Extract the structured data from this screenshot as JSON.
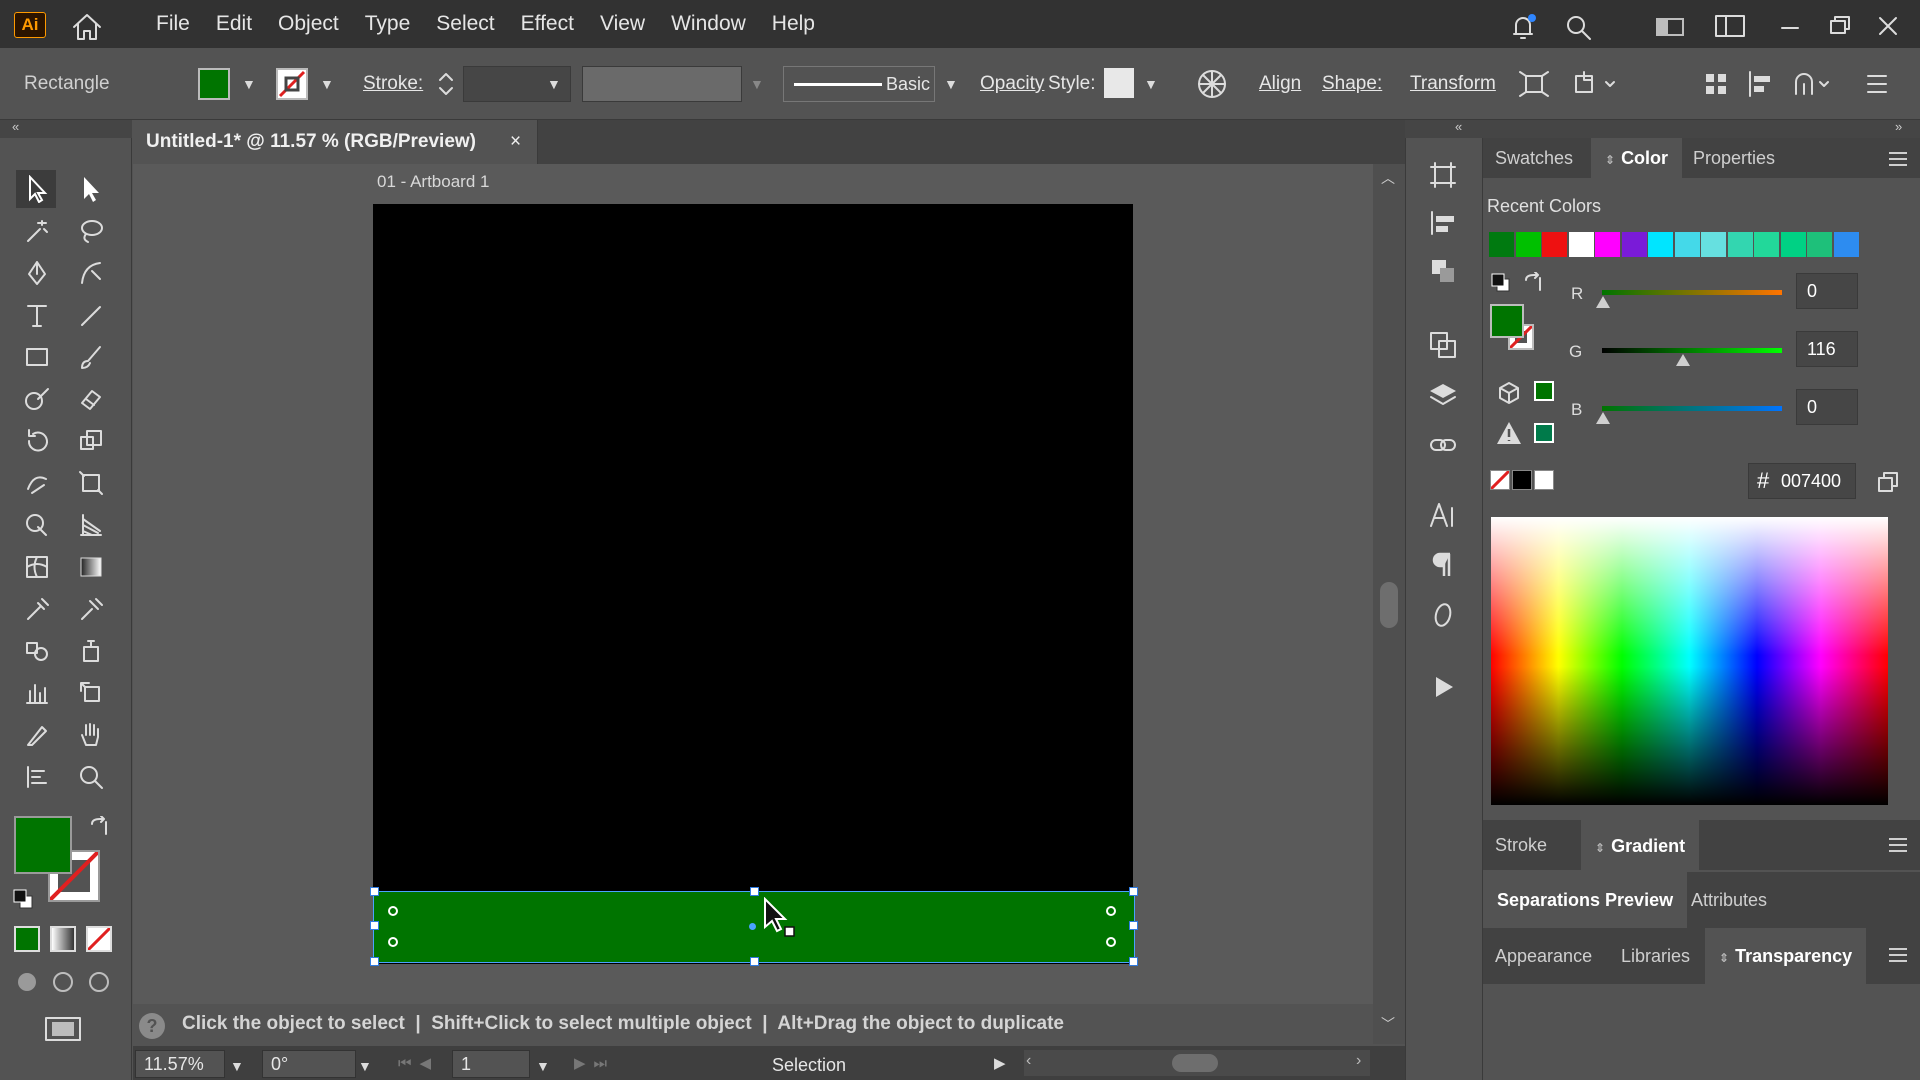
{
  "app": {
    "logo": "Ai"
  },
  "menu": [
    "File",
    "Edit",
    "Object",
    "Type",
    "Select",
    "Effect",
    "View",
    "Window",
    "Help"
  ],
  "control_bar": {
    "selection_label": "Rectangle",
    "fill_color": "#007400",
    "stroke_label": "Stroke:",
    "brush_label": "Basic",
    "opacity_label": "Opacity",
    "style_label": "Style:",
    "align_label": "Align",
    "shape_label": "Shape:",
    "transform_label": "Transform"
  },
  "document": {
    "tab_title": "Untitled-1* @ 11.57 % (RGB/Preview)",
    "tab_close": "×",
    "artboard_label": "01 - Artboard 1",
    "artboard_color": "#000000",
    "rect_color": "#007400"
  },
  "hint": {
    "text": "Click the object to select  |  Shift+Click to select multiple object  |  Alt+Drag the object to duplicate",
    "help_icon": "?"
  },
  "status": {
    "zoom": "11.57%",
    "rotation": "0°",
    "artboard_num": "1",
    "tool": "Selection"
  },
  "color_panel": {
    "tabs": [
      "Swatches",
      "Color",
      "Properties"
    ],
    "active_tab": "Color",
    "recent_label": "Recent Colors",
    "recent_colors": [
      "#007a10",
      "#00c000",
      "#ee1111",
      "#ffffff",
      "#ff00ff",
      "#7a1bd8",
      "#00e5ff",
      "#44d9e9",
      "#66e0e0",
      "#33d6b0",
      "#22d89a",
      "#00d184",
      "#1ec07a",
      "#2d8cf0"
    ],
    "r_label": "R",
    "r_value": "0",
    "g_label": "G",
    "g_value": "116",
    "b_label": "B",
    "b_value": "0",
    "hex_symbol": "#",
    "hex": "007400"
  },
  "panel_groups": {
    "group1": [
      "Stroke",
      "Gradient"
    ],
    "group2": [
      "Separations Preview",
      "Attributes"
    ],
    "group3": [
      "Appearance",
      "Libraries",
      "Transparency"
    ]
  }
}
